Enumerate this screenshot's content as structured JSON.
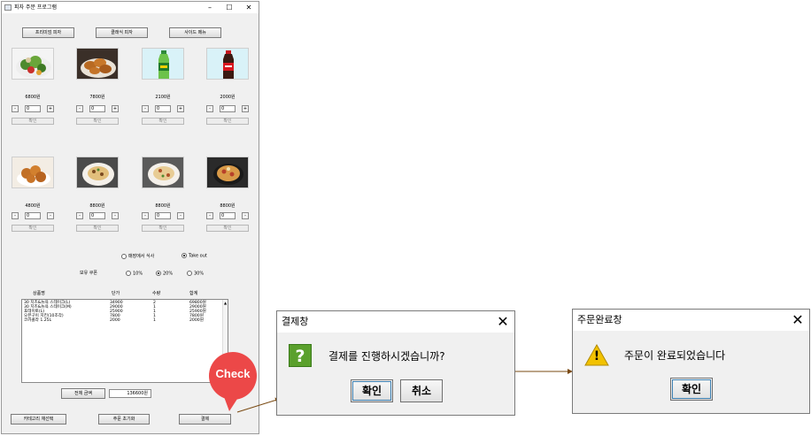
{
  "window": {
    "title": "피자 주문 프로그램"
  },
  "top_buttons": [
    "프리미엄 피자",
    "클래식 피자",
    "사이드 메뉴"
  ],
  "products": [
    {
      "price": "6800원",
      "qty": "0",
      "ok": "확인",
      "icon": "salad-image"
    },
    {
      "price": "7800원",
      "qty": "0",
      "ok": "확인",
      "icon": "fried-chicken-image"
    },
    {
      "price": "2100원",
      "qty": "0",
      "ok": "확인",
      "icon": "soda-bottle-image"
    },
    {
      "price": "2000원",
      "qty": "0",
      "ok": "확인",
      "icon": "cola-bottle-image"
    },
    {
      "price": "4800원",
      "qty": "0",
      "ok": "확인",
      "icon": "nuggets-image"
    },
    {
      "price": "8800원",
      "qty": "0",
      "ok": "확인",
      "icon": "pasta-image"
    },
    {
      "price": "8800원",
      "qty": "0",
      "ok": "확인",
      "icon": "pasta-image"
    },
    {
      "price": "8800원",
      "qty": "0",
      "ok": "확인",
      "icon": "baked-dish-image"
    }
  ],
  "stepper": {
    "minus": "-",
    "plus": "+"
  },
  "dine": {
    "options": [
      "매장에서 식사",
      "Take out"
    ],
    "selected": "Take out"
  },
  "coupon": {
    "label": "보유 쿠폰",
    "options": [
      "10%",
      "20%",
      "30%"
    ],
    "selected": "20%"
  },
  "table": {
    "headers": [
      "상품명",
      "단가",
      "수량",
      "합계"
    ],
    "rows": [
      [
        "30 치즈&뉴욕 스테이크(L)",
        "34900",
        "2",
        "69800원"
      ],
      [
        "30 치즈&뉴욕 스테이크(M)",
        "29000",
        "1",
        "29000원"
      ],
      [
        "포테이토(L)",
        "25900",
        "1",
        "25900원"
      ],
      [
        "오븐구이 치킨(10조각)",
        "7800",
        "1",
        "7800원"
      ],
      [
        "코카콜라 1.25L",
        "2000",
        "1",
        "2000원"
      ]
    ]
  },
  "total": {
    "label": "전체 금액",
    "value": "136600원"
  },
  "bottom_buttons": {
    "category": "카테고리 재선택",
    "reset": "주문 초기화",
    "pay": "결제"
  },
  "callout": {
    "text": "Check",
    "color": "#ec4848"
  },
  "confirm_dialog": {
    "title": "결제창",
    "message": "결제를 진행하시겠습니까?",
    "ok": "확인",
    "cancel": "취소",
    "close": "✕",
    "icon_glyph": "?"
  },
  "done_dialog": {
    "title": "주문완료창",
    "message": "주문이 완료되었습니다",
    "ok": "확인",
    "close": "✕",
    "icon_glyph": "!"
  },
  "colors": {
    "arrow": "#7a4a12",
    "question_icon": "#5aa02c",
    "warning_icon": "#f2c200"
  }
}
